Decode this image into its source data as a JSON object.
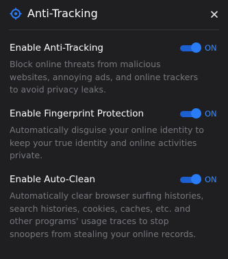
{
  "header": {
    "title": "Anti-Tracking",
    "icon": "crosshair-target-icon",
    "close_icon": "close-icon"
  },
  "settings": [
    {
      "label": "Enable Anti-Tracking",
      "state": "ON",
      "enabled": true,
      "description_lines": [
        "Block online threats from malicious",
        "websites, annoying ads, and online trackers",
        "to avoid privacy leaks."
      ]
    },
    {
      "label": "Enable Fingerprint Protection",
      "state": "ON",
      "enabled": true,
      "description_lines": [
        "Automatically disguise your online identity to",
        "keep your true identity and online activities",
        "private."
      ]
    },
    {
      "label": "Enable Auto-Clean",
      "state": "ON",
      "enabled": true,
      "description_lines": [
        "Automatically clear browser surfing histories,",
        "search histories, cookies, caches, etc. and",
        "other programs' usage traces to stop",
        "snoopers from stealing your online records."
      ]
    }
  ],
  "colors": {
    "background": "#1f1f21",
    "accent": "#2a7cf6",
    "label": "#ffffff",
    "description": "#76787d"
  }
}
